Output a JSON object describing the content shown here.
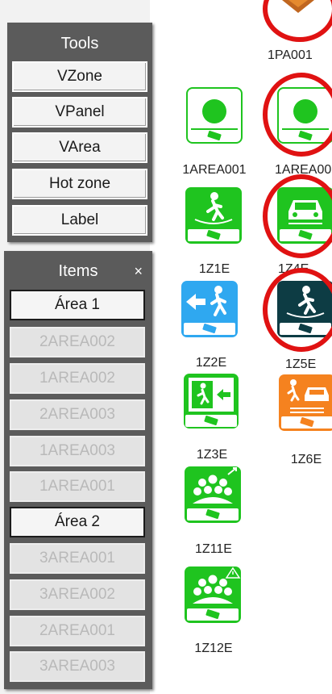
{
  "tools": {
    "title": "Tools",
    "buttons": [
      "VZone",
      "VPanel",
      "VArea",
      "Hot zone",
      "Label"
    ]
  },
  "items": {
    "title": "Items",
    "close": "×",
    "list": [
      {
        "label": "Área 1",
        "state": "active"
      },
      {
        "label": "2AREA002",
        "state": "disabled"
      },
      {
        "label": "1AREA002",
        "state": "disabled"
      },
      {
        "label": "2AREA003",
        "state": "disabled"
      },
      {
        "label": "1AREA003",
        "state": "disabled"
      },
      {
        "label": "1AREA001",
        "state": "disabled"
      },
      {
        "label": "Área 2",
        "state": "active"
      },
      {
        "label": "3AREA001",
        "state": "disabled"
      },
      {
        "label": "3AREA002",
        "state": "disabled"
      },
      {
        "label": "2AREA001",
        "state": "disabled"
      },
      {
        "label": "3AREA003",
        "state": "disabled"
      }
    ]
  },
  "canvas": {
    "labels": {
      "pa001": "1PA001",
      "area001_left": "1AREA001",
      "area001_right": "1AREA00",
      "z1e": "1Z1E",
      "z4e": "1Z4E",
      "z2e": "1Z2E",
      "z5e": "1Z5E",
      "z3e": "1Z3E",
      "z6e": "1Z6E",
      "z11e": "1Z11E",
      "z12e": "1Z12E"
    },
    "colors": {
      "green": "#1fc41f",
      "blue": "#2fa8f0",
      "dark_teal": "#0d3c44",
      "orange": "#f5821f",
      "highlight_red": "#e01212"
    },
    "icons": {
      "area001_left": "green-dot-camera-icon",
      "area001_right": "green-dot-camera-icon",
      "z1e": "person-walking-camera-icon",
      "z4e": "car-camera-icon",
      "z2e": "exit-arrow-person-icon",
      "z5e": "person-walking-dark-icon",
      "z3e": "emergency-exit-icon",
      "z6e": "person-car-orange-icon",
      "z11e": "crowd-arrow-icon",
      "z12e": "crowd-warning-icon"
    }
  }
}
